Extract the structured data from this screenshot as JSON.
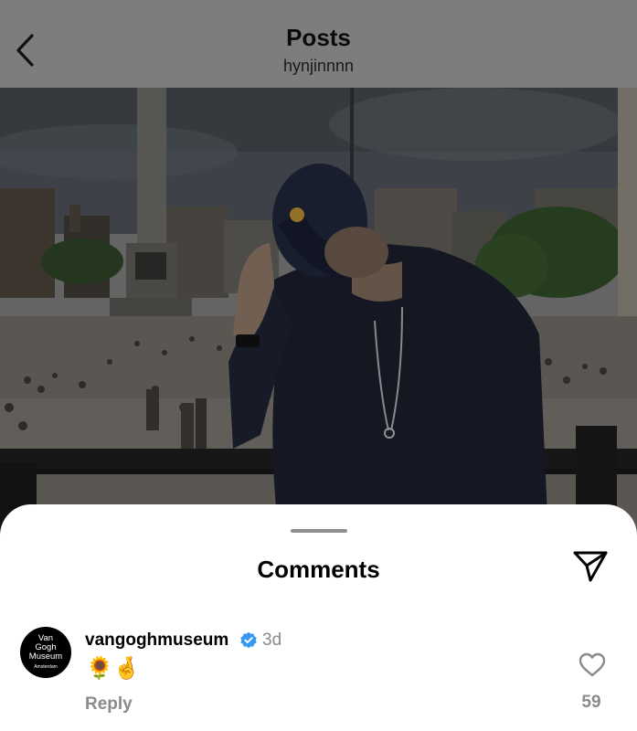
{
  "header": {
    "title": "Posts",
    "username": "hynjinnnn",
    "back_icon": "chevron-left-icon"
  },
  "photo": {
    "alt": "post-photo"
  },
  "comments_sheet": {
    "title": "Comments",
    "share_icon": "send-icon",
    "comments": [
      {
        "avatar_lines": [
          "Van",
          "Gogh",
          "Museum",
          "Amsterdam"
        ],
        "username": "vangoghmuseum",
        "verified": true,
        "time": "3d",
        "text": "🌻🤞",
        "reply_label": "Reply",
        "like_icon": "heart-outline-icon",
        "likes": "59"
      }
    ]
  },
  "colors": {
    "overlay": "#7a7a7a",
    "verified_blue": "#3897f0",
    "muted_text": "#8a8a8a"
  }
}
